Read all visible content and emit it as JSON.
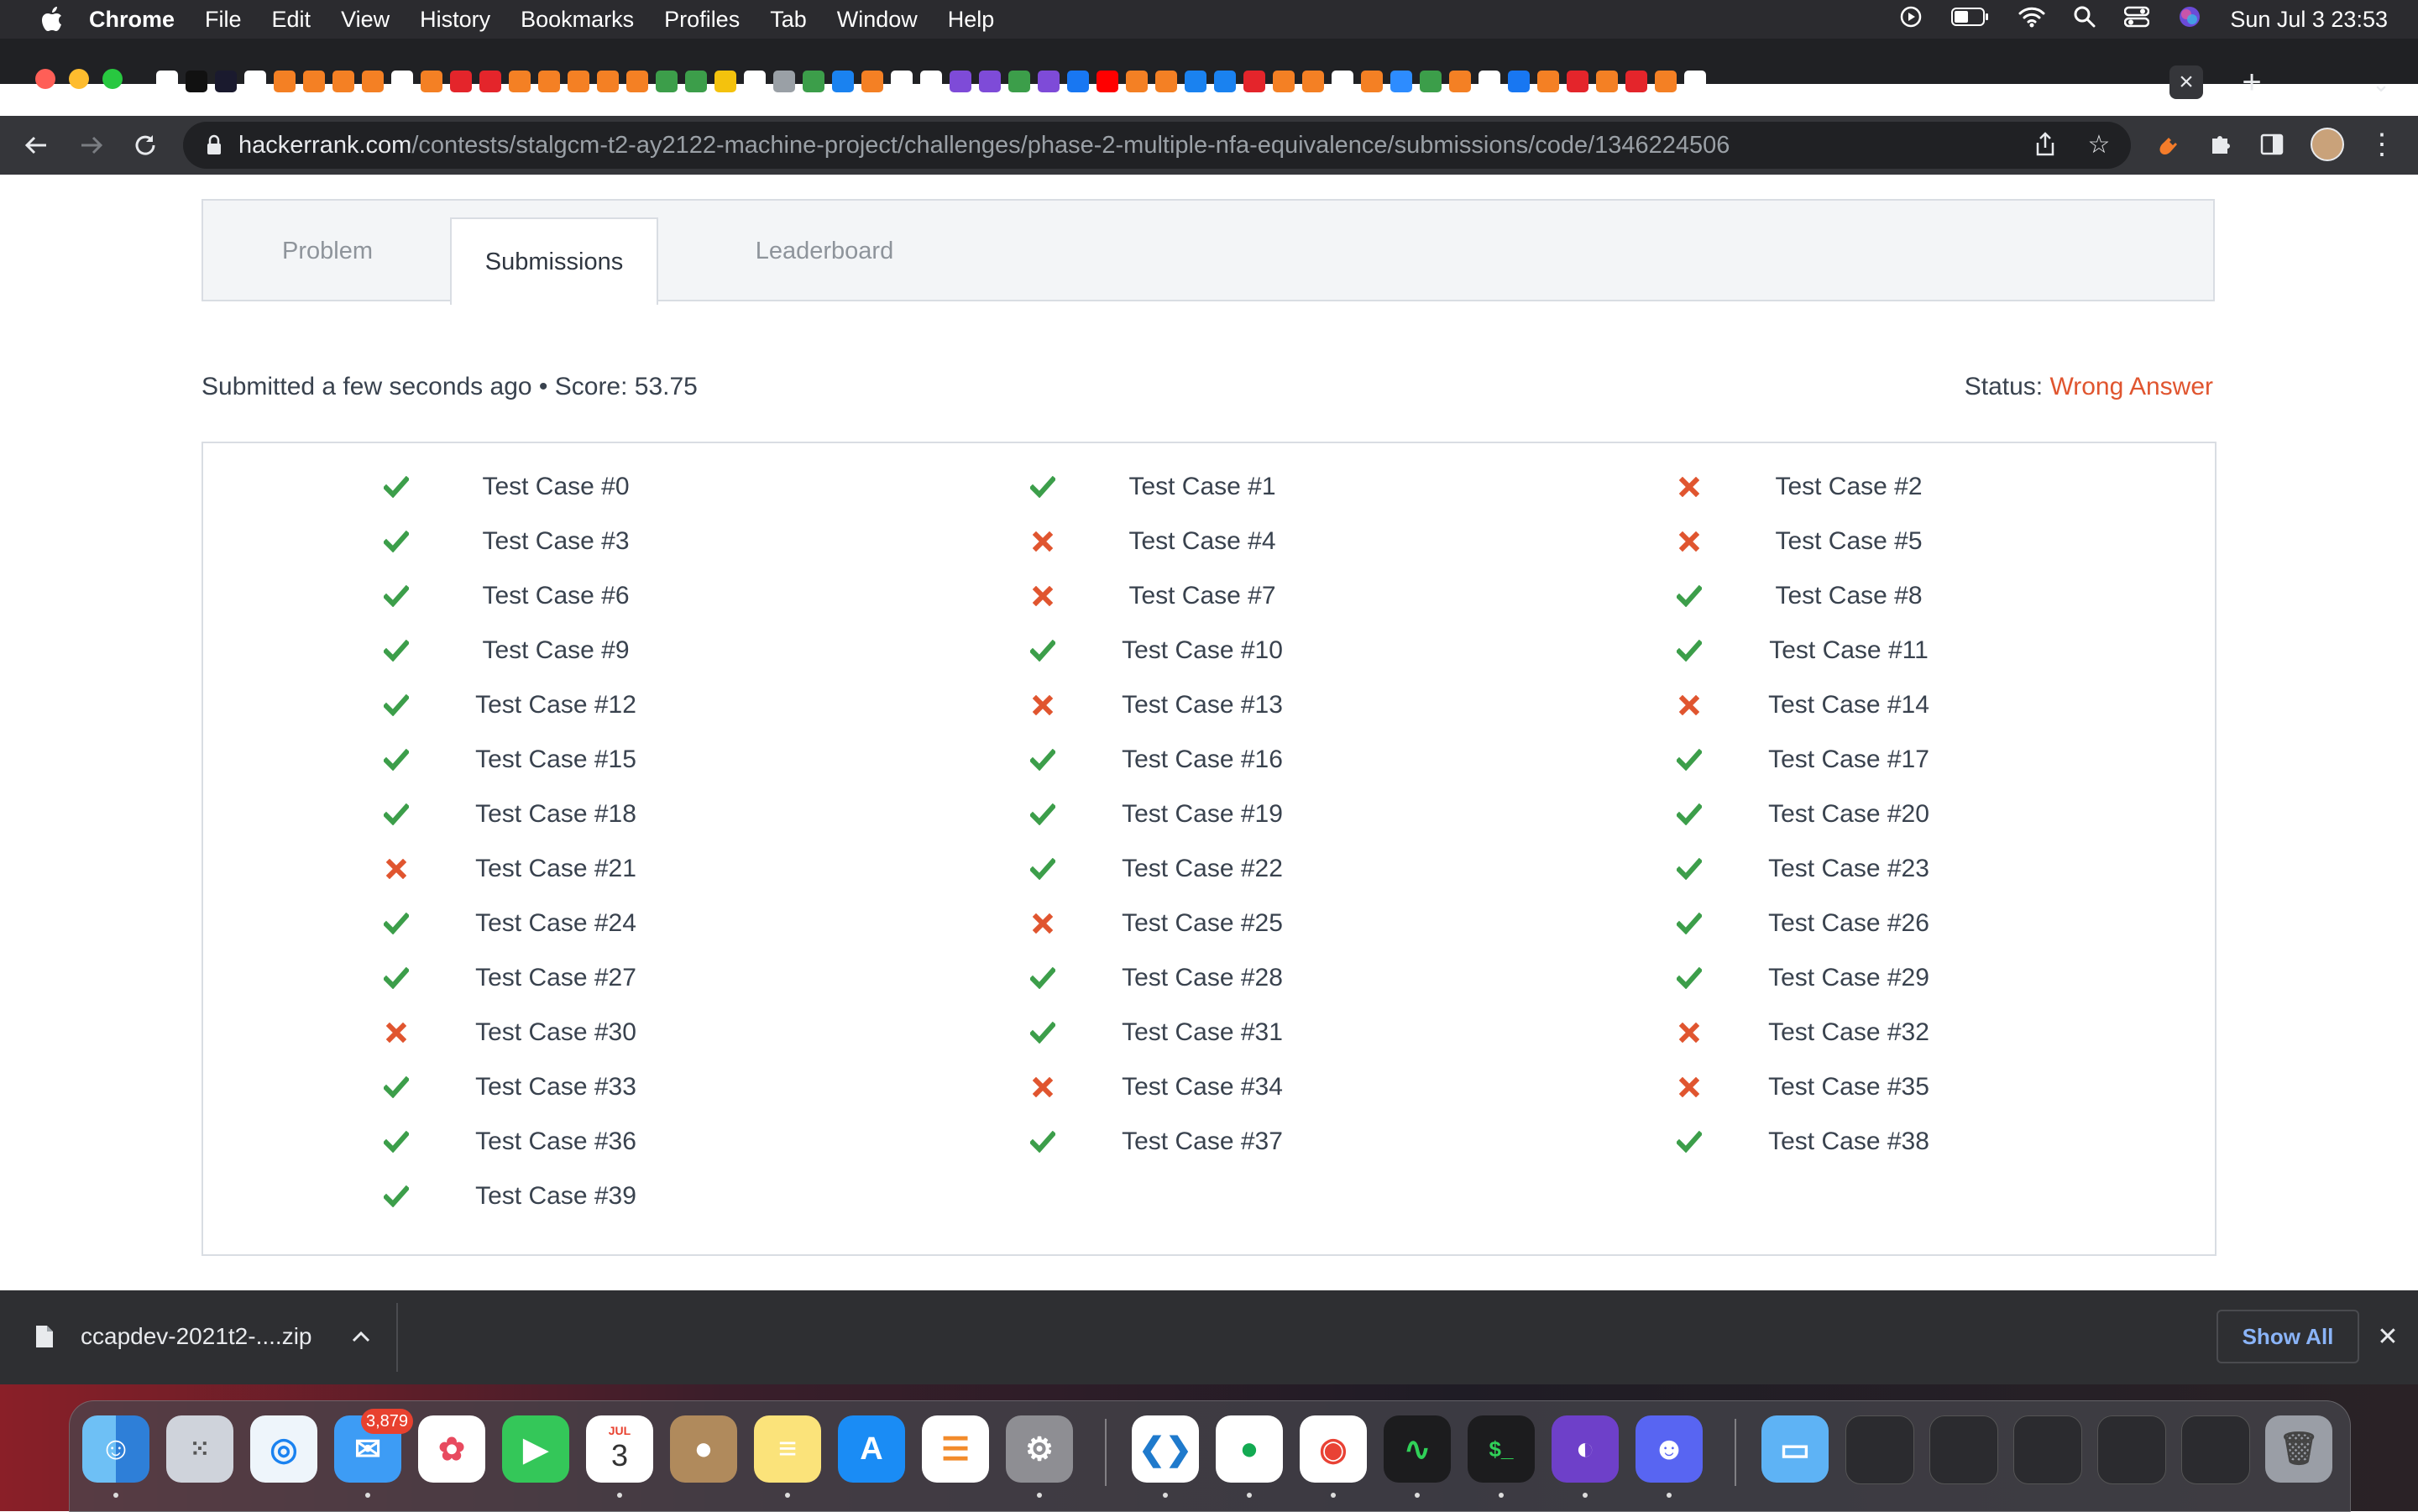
{
  "menubar": {
    "app_name": "Chrome",
    "items": [
      "File",
      "Edit",
      "View",
      "History",
      "Bookmarks",
      "Profiles",
      "Tab",
      "Window",
      "Help"
    ],
    "clock": "Sun Jul 3  23:53"
  },
  "browser": {
    "url_host": "hackerrank.com",
    "url_path": "/contests/stalgcm-t2-ay2122-machine-project/challenges/phase-2-multiple-nfa-equivalence/submissions/code/1346224506"
  },
  "page": {
    "tabs": [
      "Problem",
      "Submissions",
      "Leaderboard"
    ],
    "active_tab": "Submissions",
    "summary": "Submitted a few seconds ago • Score: 53.75",
    "status_label": "Status:",
    "status_value": "Wrong Answer",
    "colors": {
      "pass": "#3c9e4a",
      "fail": "#e0552f"
    },
    "test_cases": [
      {
        "label": "Test Case #0",
        "result": "pass"
      },
      {
        "label": "Test Case #1",
        "result": "pass"
      },
      {
        "label": "Test Case #2",
        "result": "fail"
      },
      {
        "label": "Test Case #3",
        "result": "pass"
      },
      {
        "label": "Test Case #4",
        "result": "fail"
      },
      {
        "label": "Test Case #5",
        "result": "fail"
      },
      {
        "label": "Test Case #6",
        "result": "pass"
      },
      {
        "label": "Test Case #7",
        "result": "fail"
      },
      {
        "label": "Test Case #8",
        "result": "pass"
      },
      {
        "label": "Test Case #9",
        "result": "pass"
      },
      {
        "label": "Test Case #10",
        "result": "pass"
      },
      {
        "label": "Test Case #11",
        "result": "pass"
      },
      {
        "label": "Test Case #12",
        "result": "pass"
      },
      {
        "label": "Test Case #13",
        "result": "fail"
      },
      {
        "label": "Test Case #14",
        "result": "fail"
      },
      {
        "label": "Test Case #15",
        "result": "pass"
      },
      {
        "label": "Test Case #16",
        "result": "pass"
      },
      {
        "label": "Test Case #17",
        "result": "pass"
      },
      {
        "label": "Test Case #18",
        "result": "pass"
      },
      {
        "label": "Test Case #19",
        "result": "pass"
      },
      {
        "label": "Test Case #20",
        "result": "pass"
      },
      {
        "label": "Test Case #21",
        "result": "fail"
      },
      {
        "label": "Test Case #22",
        "result": "pass"
      },
      {
        "label": "Test Case #23",
        "result": "pass"
      },
      {
        "label": "Test Case #24",
        "result": "pass"
      },
      {
        "label": "Test Case #25",
        "result": "fail"
      },
      {
        "label": "Test Case #26",
        "result": "pass"
      },
      {
        "label": "Test Case #27",
        "result": "pass"
      },
      {
        "label": "Test Case #28",
        "result": "pass"
      },
      {
        "label": "Test Case #29",
        "result": "pass"
      },
      {
        "label": "Test Case #30",
        "result": "fail"
      },
      {
        "label": "Test Case #31",
        "result": "pass"
      },
      {
        "label": "Test Case #32",
        "result": "fail"
      },
      {
        "label": "Test Case #33",
        "result": "pass"
      },
      {
        "label": "Test Case #34",
        "result": "fail"
      },
      {
        "label": "Test Case #35",
        "result": "fail"
      },
      {
        "label": "Test Case #36",
        "result": "pass"
      },
      {
        "label": "Test Case #37",
        "result": "pass"
      },
      {
        "label": "Test Case #38",
        "result": "pass"
      },
      {
        "label": "Test Case #39",
        "result": "pass"
      }
    ]
  },
  "download_bar": {
    "file_name": "ccapdev-2021t2-....zip",
    "show_all": "Show All"
  },
  "dock": {
    "mail_badge": "3,879",
    "calendar_month": "JUL",
    "calendar_day": "3"
  }
}
